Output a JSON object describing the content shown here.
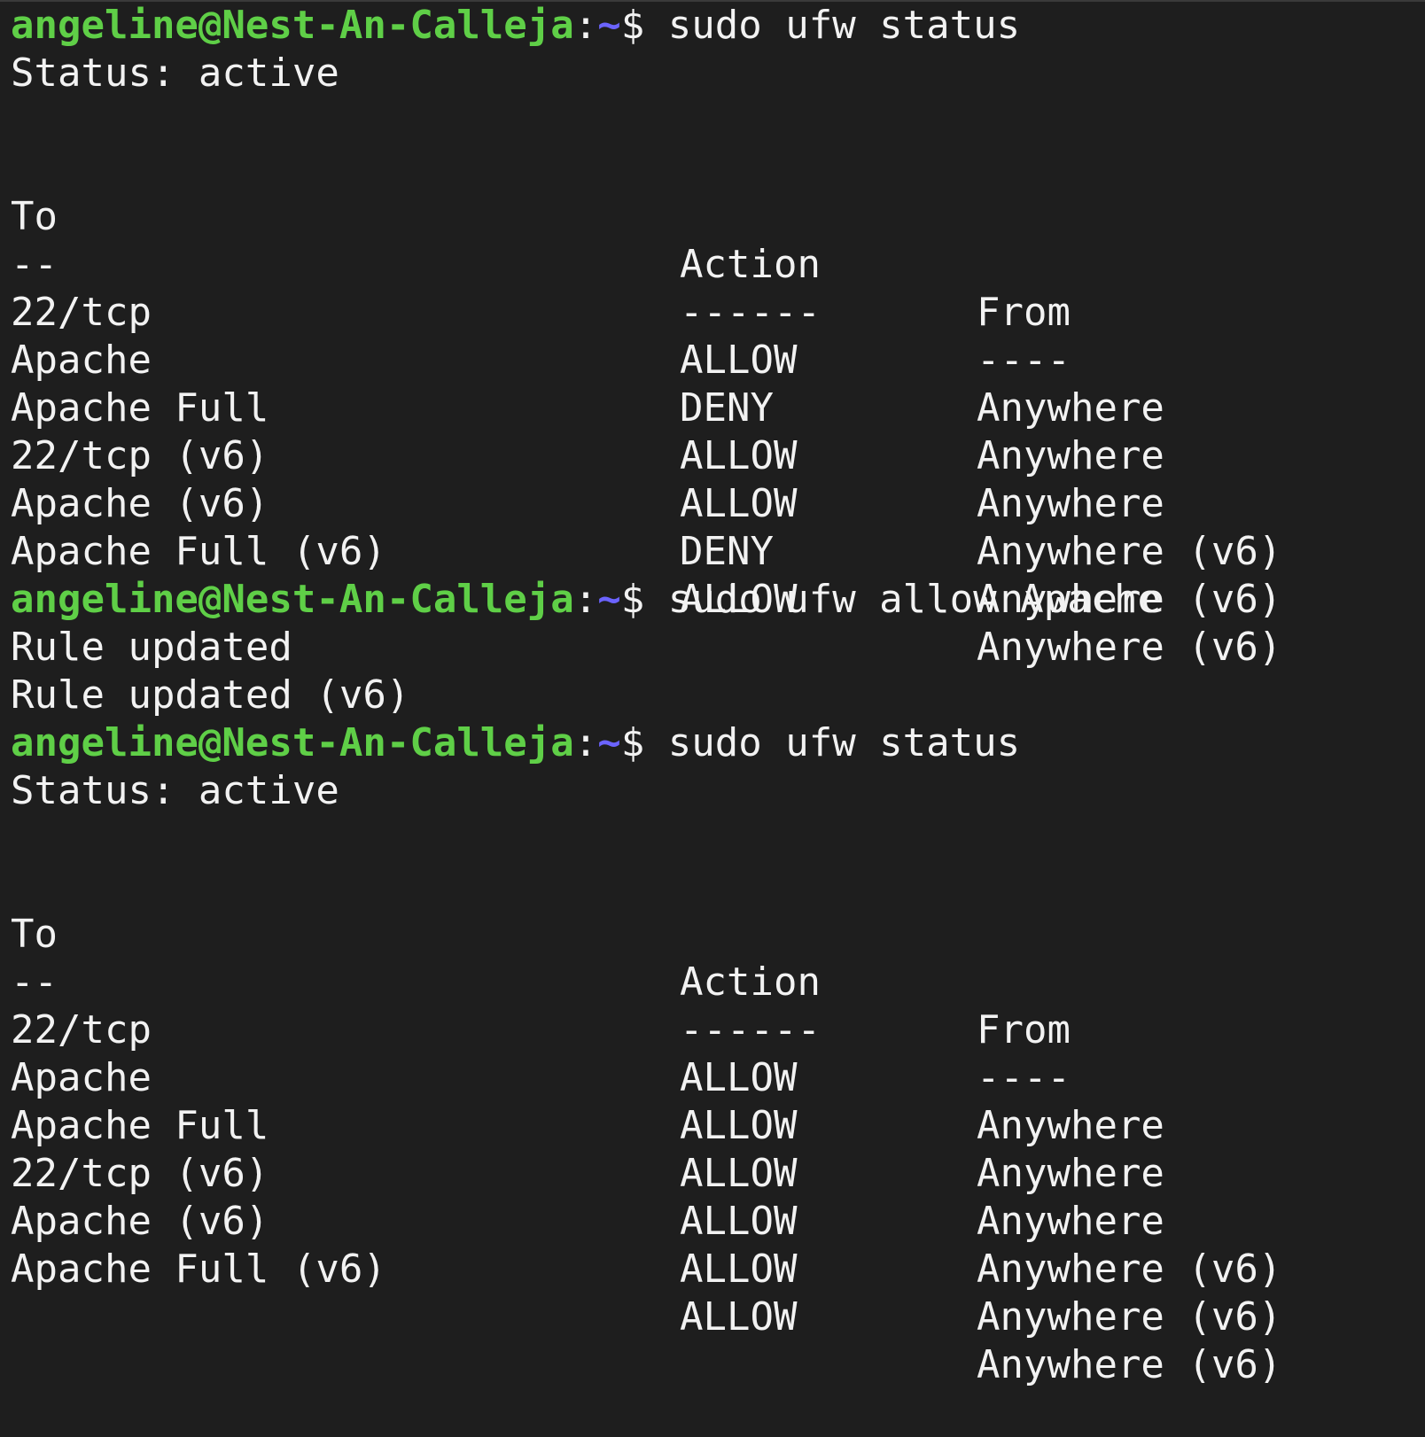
{
  "prompt": {
    "user_host": "angeline@Nest-An-Calleja",
    "colon": ":",
    "path": "~",
    "symbol": "$"
  },
  "colors": {
    "background": "#1e1e1e",
    "text": "#f2f2f2",
    "user_host": "#5fcf47",
    "path": "#6b63ff"
  },
  "blocks": [
    {
      "command": " sudo ufw status",
      "status_line": "Status: active",
      "table": {
        "headers": {
          "to": "To",
          "action": "Action",
          "from": "From"
        },
        "separators": {
          "to": "--",
          "action": "------",
          "from": "----"
        },
        "rows": [
          {
            "to": "22/tcp",
            "action": "ALLOW",
            "from": "Anywhere"
          },
          {
            "to": "Apache",
            "action": "DENY",
            "from": "Anywhere"
          },
          {
            "to": "Apache Full",
            "action": "ALLOW",
            "from": "Anywhere"
          },
          {
            "to": "22/tcp (v6)",
            "action": "ALLOW",
            "from": "Anywhere (v6)"
          },
          {
            "to": "Apache (v6)",
            "action": "DENY",
            "from": "Anywhere (v6)"
          },
          {
            "to": "Apache Full (v6)",
            "action": "ALLOW",
            "from": "Anywhere (v6)"
          }
        ]
      }
    },
    {
      "command": " sudo ufw allow Apache",
      "output": [
        "Rule updated",
        "Rule updated (v6)"
      ]
    },
    {
      "command": " sudo ufw status",
      "status_line": "Status: active",
      "table": {
        "headers": {
          "to": "To",
          "action": "Action",
          "from": "From"
        },
        "separators": {
          "to": "--",
          "action": "------",
          "from": "----"
        },
        "rows": [
          {
            "to": "22/tcp",
            "action": "ALLOW",
            "from": "Anywhere"
          },
          {
            "to": "Apache",
            "action": "ALLOW",
            "from": "Anywhere"
          },
          {
            "to": "Apache Full",
            "action": "ALLOW",
            "from": "Anywhere"
          },
          {
            "to": "22/tcp (v6)",
            "action": "ALLOW",
            "from": "Anywhere (v6)"
          },
          {
            "to": "Apache (v6)",
            "action": "ALLOW",
            "from": "Anywhere (v6)"
          },
          {
            "to": "Apache Full (v6)",
            "action": "ALLOW",
            "from": "Anywhere (v6)"
          }
        ]
      }
    }
  ]
}
